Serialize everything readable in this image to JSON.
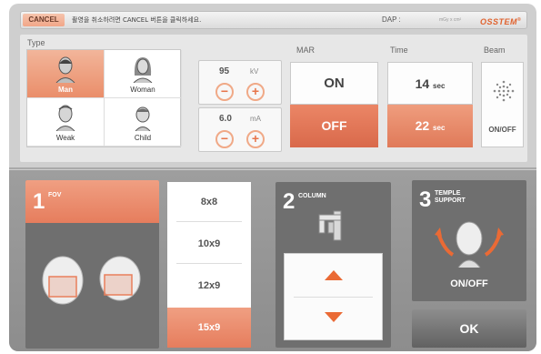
{
  "topbar": {
    "cancel_label": "CANCEL",
    "message": "촬영을 취소하려면 CANCEL 버튼을 클릭하세요.",
    "dap_label": "DAP :",
    "dap_unit": "mGy x cm²",
    "brand": "OSSTEM",
    "brand_mark": "®"
  },
  "type": {
    "label": "Type",
    "options": [
      {
        "label": "Man",
        "selected": true,
        "icon": "man-head-icon"
      },
      {
        "label": "Woman",
        "selected": false,
        "icon": "woman-head-icon"
      },
      {
        "label": "Weak",
        "selected": false,
        "icon": "weak-head-icon"
      },
      {
        "label": "Child",
        "selected": false,
        "icon": "child-head-icon"
      }
    ]
  },
  "kv": {
    "value": "95",
    "unit": "kV",
    "minus": "−",
    "plus": "+"
  },
  "ma": {
    "value": "6.0",
    "unit": "mA",
    "minus": "−",
    "plus": "+"
  },
  "mar": {
    "label": "MAR",
    "on_label": "ON",
    "off_label": "OFF",
    "selected": "OFF"
  },
  "time": {
    "label": "Time",
    "options": [
      {
        "value": "14",
        "unit": "sec",
        "selected": false
      },
      {
        "value": "22",
        "unit": "sec",
        "selected": true
      }
    ]
  },
  "beam": {
    "label": "Beam",
    "toggle_label": "ON/OFF",
    "icon": "beam-dots-icon"
  },
  "fov": {
    "number": "1",
    "label": "FOV",
    "options": [
      {
        "label": "8x8",
        "selected": false
      },
      {
        "label": "10x9",
        "selected": false
      },
      {
        "label": "12x9",
        "selected": false
      },
      {
        "label": "15x9",
        "selected": true
      }
    ]
  },
  "column": {
    "number": "2",
    "label": "COLUMN",
    "up_icon": "arrow-up-icon",
    "down_icon": "arrow-down-icon"
  },
  "temple_support": {
    "number": "3",
    "label_line1": "TEMPLE",
    "label_line2": "SUPPORT",
    "toggle_label": "ON/OFF"
  },
  "ok_label": "OK",
  "colors": {
    "accent": "#e67d5d",
    "arrow": "#ea6a35",
    "brand": "#e0622e",
    "panel_dark": "#6f6f6f"
  }
}
